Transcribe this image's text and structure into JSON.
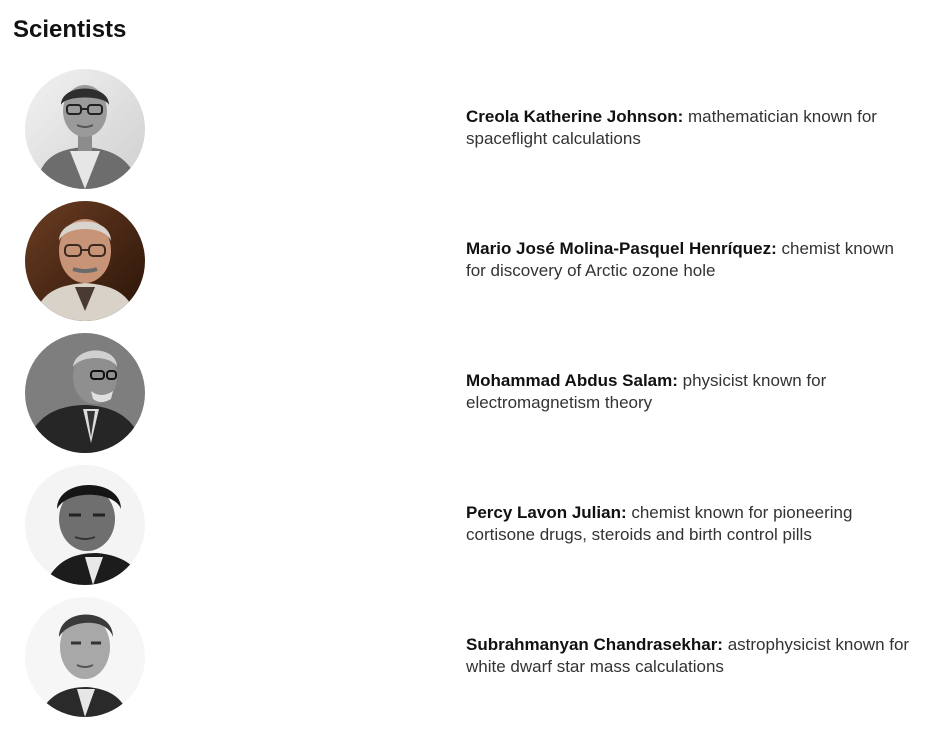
{
  "page": {
    "title": "Scientists"
  },
  "scientists": [
    {
      "name": "Creola Katherine Johnson:",
      "description": " mathematician known for spaceflight calculations",
      "portrait": "portrait-creola-katherine-johnson"
    },
    {
      "name": "Mario José Molina-Pasquel Henríquez:",
      "description": " chemist known for discovery of Arctic ozone hole",
      "portrait": "portrait-mario-jose-molina"
    },
    {
      "name": "Mohammad Abdus Salam:",
      "description": " physicist known for electromagnetism theory",
      "portrait": "portrait-mohammad-abdus-salam"
    },
    {
      "name": "Percy Lavon Julian:",
      "description": " chemist known for pioneering cortisone drugs, steroids and birth control pills",
      "portrait": "portrait-percy-lavon-julian"
    },
    {
      "name": "Subrahmanyan Chandrasekhar:",
      "description": " astrophysicist known for white dwarf star mass calculations",
      "portrait": "portrait-subrahmanyan-chandrasekhar"
    }
  ]
}
